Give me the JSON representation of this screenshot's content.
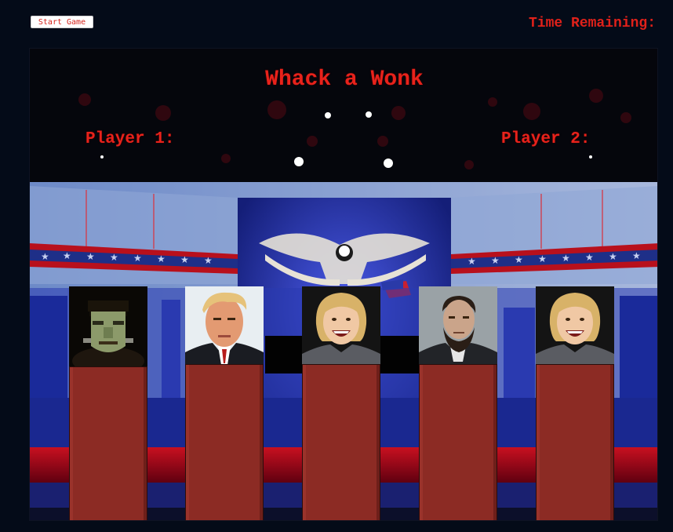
{
  "controls": {
    "start_label": "Start Game",
    "time_label": "Time Remaining:"
  },
  "game": {
    "title": "Whack a Wonk",
    "player1_label": "Player 1:",
    "player2_label": "Player 2:"
  },
  "holes": [
    {
      "character": "frankenstein-monster",
      "raised": true
    },
    {
      "character": "trump",
      "raised": true
    },
    {
      "character": "hillary",
      "raised": true
    },
    {
      "character": "lincoln",
      "raised": true
    },
    {
      "character": "hillary",
      "raised": true
    }
  ],
  "colors": {
    "accent_red": "#e8221b",
    "pillar": "#8c2b24",
    "page_bg": "#040b18"
  }
}
